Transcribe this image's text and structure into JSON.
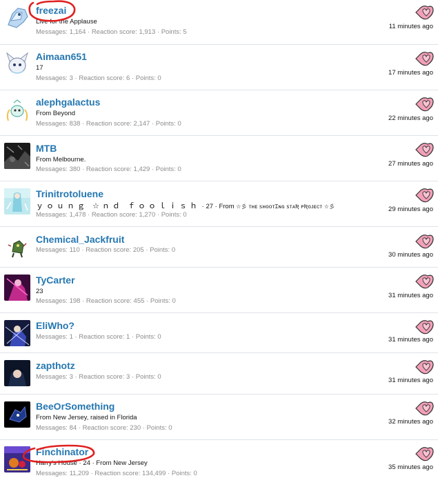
{
  "members": [
    {
      "username": "freezai",
      "blurb": "Live for the Applause",
      "messages": "1,164",
      "reaction_score": "1,913",
      "points": "5",
      "time": "11 minutes ago"
    },
    {
      "username": "Aimaan651",
      "blurb": "17",
      "messages": "3",
      "reaction_score": "6",
      "points": "0",
      "time": "17 minutes ago"
    },
    {
      "username": "alephgalactus",
      "blurb": "From Beyond",
      "messages": "838",
      "reaction_score": "2,147",
      "points": "0",
      "time": "22 minutes ago"
    },
    {
      "username": "MTB",
      "blurb": "From Melbourne.",
      "messages": "380",
      "reaction_score": "1,429",
      "points": "0",
      "time": "27 minutes ago"
    },
    {
      "username": "Trinitrotoluene",
      "blurb_custom": "ｙｏｕｎｇ ☆ｎｄ ｆｏｏｌｉｓｈ",
      "blurb_age": "27",
      "blurb_from_label": "From",
      "blurb_from": "☆彡 ᴛʜᴇ ꜱʜᴏᴏᴛɪɴɢ ꜱᴛᴀʀ ᴘʀᴏᴊᴇᴄᴛ ☆彡",
      "messages": "1,478",
      "reaction_score": "1,270",
      "points": "0",
      "time": "29 minutes ago"
    },
    {
      "username": "Chemical_Jackfruit",
      "messages": "110",
      "reaction_score": "205",
      "points": "0",
      "time": "30 minutes ago"
    },
    {
      "username": "TyCarter",
      "blurb": "23",
      "messages": "198",
      "reaction_score": "455",
      "points": "0",
      "time": "31 minutes ago"
    },
    {
      "username": "EliWho?",
      "messages": "1",
      "reaction_score": "1",
      "points": "0",
      "time": "31 minutes ago"
    },
    {
      "username": "zapthotz",
      "messages": "3",
      "reaction_score": "3",
      "points": "0",
      "time": "31 minutes ago"
    },
    {
      "username": "BeeOrSomething",
      "blurb": "From New Jersey, raised in Florida",
      "messages": "84",
      "reaction_score": "230",
      "points": "0",
      "time": "32 minutes ago"
    },
    {
      "username": "Finchinator",
      "blurb_custom": "Harry's House",
      "blurb_age": "24",
      "blurb_from_label": "From",
      "blurb_from": "New Jersey",
      "messages": "11,209",
      "reaction_score": "134,499",
      "points": "0",
      "time": "35 minutes ago"
    }
  ],
  "labels": {
    "messages": "Messages:",
    "reaction_score": "Reaction score:",
    "points": "Points:",
    "dot": "·"
  },
  "colors": {
    "username": "#2577b1",
    "annotation_circle": "#e02020",
    "heart": "#f2a0b8"
  },
  "icons": {
    "follow": "heart-speech-bubble-icon",
    "annotation": "red-hand-drawn-circle"
  }
}
